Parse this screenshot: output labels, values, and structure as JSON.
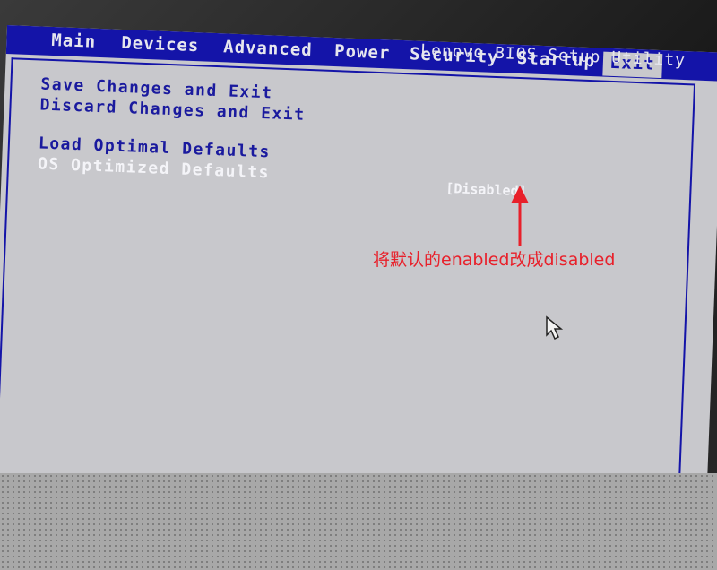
{
  "menu": {
    "items": [
      {
        "label": "Main"
      },
      {
        "label": "Devices"
      },
      {
        "label": "Advanced"
      },
      {
        "label": "Power"
      },
      {
        "label": "Security"
      },
      {
        "label": "Startup"
      },
      {
        "label": "Exit"
      }
    ],
    "active": "Exit",
    "title": "Lenovo BIOS Setup Utility"
  },
  "options": {
    "save_exit": "Save Changes and Exit",
    "discard_exit": "Discard Changes and Exit",
    "load_optimal": "Load Optimal Defaults",
    "os_optimized": "OS Optimized Defaults"
  },
  "selected_value": "[Disabled]",
  "annotation": "将默认的enabled改成disabled",
  "colors": {
    "menubar_bg": "#1414a8",
    "screen_bg": "#c8c8cc",
    "option_text": "#1a1a9e",
    "selected_text": "#f4f4f8",
    "annotation": "#e8202a"
  },
  "icons": {
    "annotation_arrow": "red-arrow-icon",
    "mouse_pointer": "mouse-pointer-icon"
  }
}
